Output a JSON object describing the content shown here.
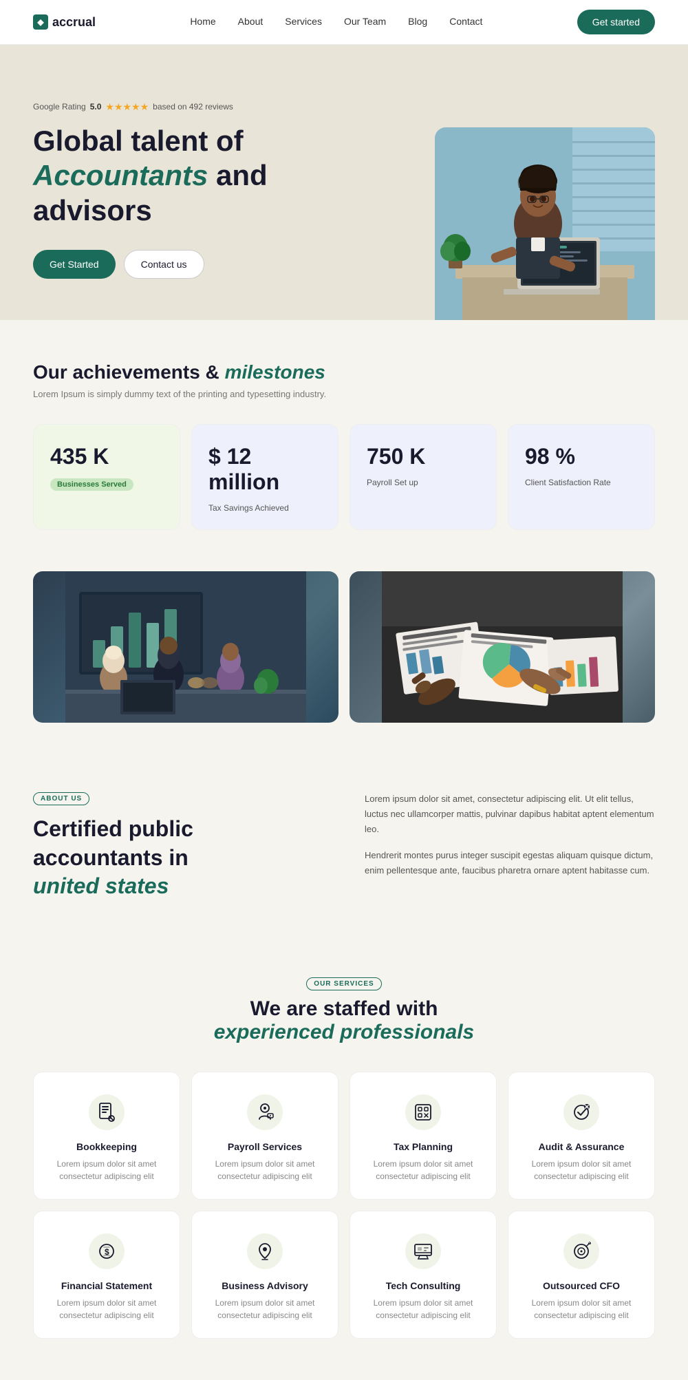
{
  "brand": {
    "name": "accrual"
  },
  "nav": {
    "links": [
      "Home",
      "About",
      "Services",
      "Our Team",
      "Blog",
      "Contact"
    ],
    "cta": "Get started"
  },
  "hero": {
    "rating_label": "Google Rating",
    "rating_value": "5.0",
    "rating_reviews": "based on 492 reviews",
    "title_line1": "Global talent of",
    "title_italic": "Accountants",
    "title_line2": "and advisors",
    "btn_primary": "Get Started",
    "btn_secondary": "Contact us"
  },
  "achievements": {
    "section_title": "Our achievements &",
    "section_title_italic": "milestones",
    "section_subtitle": "Lorem Ipsum is simply dummy text of the printing and typesetting industry.",
    "stats": [
      {
        "number": "435 K",
        "badge": "Businesses Served",
        "badge_type": "green"
      },
      {
        "number": "$ 12 million",
        "label": "Tax Savings Achieved",
        "badge_type": "purple"
      },
      {
        "number": "750 K",
        "label": "Payroll Set up",
        "badge_type": "purple"
      },
      {
        "number": "98 %",
        "label": "Client Satisfaction Rate",
        "badge_type": "purple"
      }
    ]
  },
  "about": {
    "badge": "ABOUT US",
    "title_line1": "Certified public",
    "title_line2": "accountants in",
    "title_italic": "united states",
    "para1": "Lorem ipsum dolor sit amet, consectetur adipiscing elit. Ut elit tellus, luctus nec ullamcorper mattis, pulvinar dapibus habitat aptent elementum leo.",
    "para2": "Hendrerit montes purus integer suscipit egestas aliquam quisque dictum, enim pellentesque ante, faucibus pharetra ornare aptent habitasse cum."
  },
  "services": {
    "badge": "OUR SERVICES",
    "title": "We are staffed with",
    "title_italic": "experienced professionals",
    "items": [
      {
        "icon": "📋",
        "name": "Bookkeeping",
        "desc": "Lorem ipsum dolor sit amet consectetur adipiscing elit"
      },
      {
        "icon": "🔑",
        "name": "Payroll Services",
        "desc": "Lorem ipsum dolor sit amet consectetur adipiscing elit"
      },
      {
        "icon": "🧮",
        "name": "Tax Planning",
        "desc": "Lorem ipsum dolor sit amet consectetur adipiscing elit"
      },
      {
        "icon": "✅",
        "name": "Audit & Assurance",
        "desc": "Lorem ipsum dolor sit amet consectetur adipiscing elit"
      },
      {
        "icon": "💰",
        "name": "Financial Statement",
        "desc": "Lorem ipsum dolor sit amet consectetur adipiscing elit"
      },
      {
        "icon": "🌱",
        "name": "Business Advisory",
        "desc": "Lorem ipsum dolor sit amet consectetur adipiscing elit"
      },
      {
        "icon": "🖥",
        "name": "Tech Consulting",
        "desc": "Lorem ipsum dolor sit amet consectetur adipiscing elit"
      },
      {
        "icon": "🔍",
        "name": "Outsourced CFO",
        "desc": "Lorem ipsum dolor sit amet consectetur adipiscing elit"
      }
    ]
  }
}
